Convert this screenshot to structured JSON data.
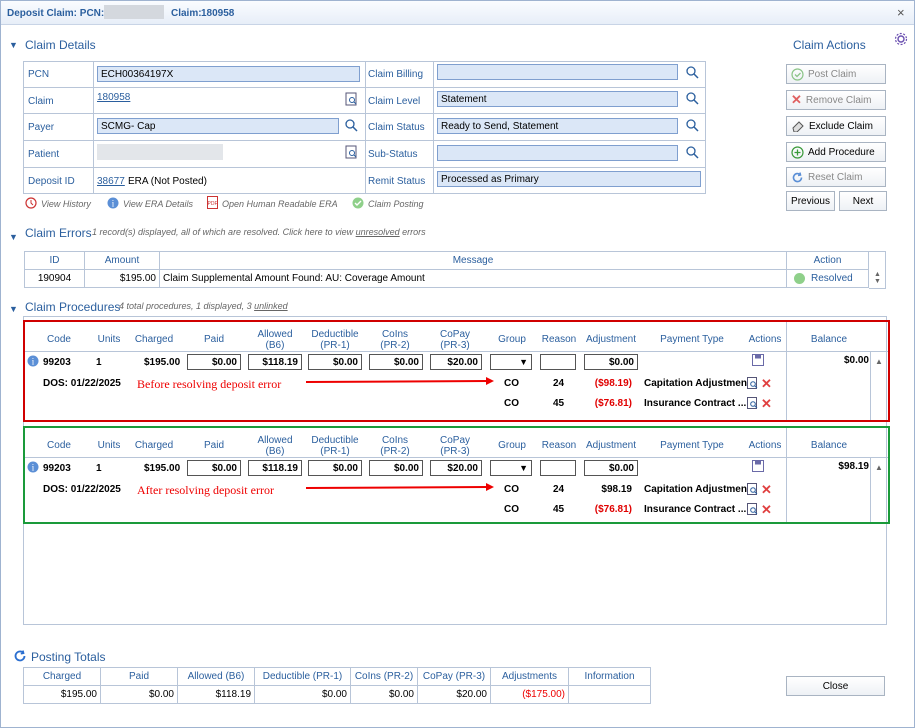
{
  "title": {
    "prefix": "Deposit Claim: PCN:",
    "claim_label": "Claim:",
    "claim_no": "180958",
    "close": "×"
  },
  "claim_details": {
    "heading": "Claim Details",
    "pcn_label": "PCN",
    "pcn": "ECH00364197X",
    "claim_label": "Claim",
    "claim": "180958",
    "payer_label": "Payer",
    "payer": "SCMG- Cap",
    "patient_label": "Patient",
    "deposit_label": "Deposit ID",
    "deposit_id": "38677",
    "deposit_text": "ERA (Not Posted)",
    "billing_label": "Claim Billing",
    "billing": "",
    "level_label": "Claim Level",
    "level": "Statement",
    "status_label": "Claim Status",
    "status": "Ready to Send, Statement",
    "substatus_label": "Sub-Status",
    "substatus": "",
    "remit_label": "Remit Status",
    "remit": "Processed as Primary",
    "links": [
      "View History",
      "View ERA Details",
      "Open Human Readable ERA",
      "Claim Posting"
    ]
  },
  "claim_actions": {
    "heading": "Claim Actions",
    "post": "Post Claim",
    "remove": "Remove Claim",
    "exclude": "Exclude Claim",
    "add": "Add Procedure",
    "reset": "Reset Claim",
    "previous": "Previous",
    "next": "Next"
  },
  "claim_errors": {
    "heading": "Claim Errors",
    "note_a": "1 record(s) displayed, all of which are resolved. Click here to view ",
    "note_link": "unresolved",
    "note_b": " errors",
    "cols": [
      "ID",
      "Amount",
      "Message",
      "Action"
    ],
    "row": {
      "id": "190904",
      "amount": "$195.00",
      "message": "Claim Supplemental Amount Found: AU: Coverage Amount",
      "action": "Resolved"
    }
  },
  "procedures": {
    "heading": "Claim Procedures",
    "note_a": "4 total procedures, 1 displayed, 3 ",
    "note_link": "unlinked",
    "cols": {
      "code": "Code",
      "units": "Units",
      "charged": "Charged",
      "paid": "Paid",
      "allowed": "Allowed",
      "allowed2": "(B6)",
      "deductible": "Deductible",
      "deductible2": "(PR-1)",
      "coins": "CoIns",
      "coins2": "(PR-2)",
      "copay": "CoPay",
      "copay2": "(PR-3)",
      "group": "Group",
      "reason": "Reason",
      "adjustment": "Adjustment",
      "ptype": "Payment Type",
      "actions": "Actions",
      "balance": "Balance"
    },
    "before": {
      "code": "99203",
      "units": "1",
      "charged": "$195.00",
      "paid": "$0.00",
      "allowed": "$118.19",
      "deductible": "$0.00",
      "coins": "$0.00",
      "copay": "$20.00",
      "adj": "$0.00",
      "balance": "$0.00",
      "dos": "DOS: 01/22/2025",
      "annotation": "Before resolving deposit error",
      "adj_rows": [
        {
          "group": "CO",
          "reason": "24",
          "amount": "($98.19)",
          "type": "Capitation Adjustment"
        },
        {
          "group": "CO",
          "reason": "45",
          "amount": "($76.81)",
          "type": "Insurance Contract ..."
        }
      ]
    },
    "after": {
      "code": "99203",
      "units": "1",
      "charged": "$195.00",
      "paid": "$0.00",
      "allowed": "$118.19",
      "deductible": "$0.00",
      "coins": "$0.00",
      "copay": "$20.00",
      "adj": "$0.00",
      "balance": "$98.19",
      "dos": "DOS: 01/22/2025",
      "annotation": "After resolving deposit error",
      "adj_rows": [
        {
          "group": "CO",
          "reason": "24",
          "amount": "$98.19",
          "type": "Capitation Adjustment"
        },
        {
          "group": "CO",
          "reason": "45",
          "amount": "($76.81)",
          "type": "Insurance Contract ..."
        }
      ]
    }
  },
  "totals": {
    "heading": "Posting Totals",
    "cols": [
      "Charged",
      "Paid",
      "Allowed (B6)",
      "Deductible (PR-1)",
      "CoIns (PR-2)",
      "CoPay (PR-3)",
      "Adjustments",
      "Information"
    ],
    "values": [
      "$195.00",
      "$0.00",
      "$118.19",
      "$0.00",
      "$0.00",
      "$20.00",
      "($175.00)",
      ""
    ]
  },
  "close_button": "Close",
  "colors": {
    "accent": "#2b5f9e",
    "field": "#dbe7f7",
    "red": "#e00000",
    "before_box": "#d00000",
    "after_box": "#1a9a3a"
  }
}
